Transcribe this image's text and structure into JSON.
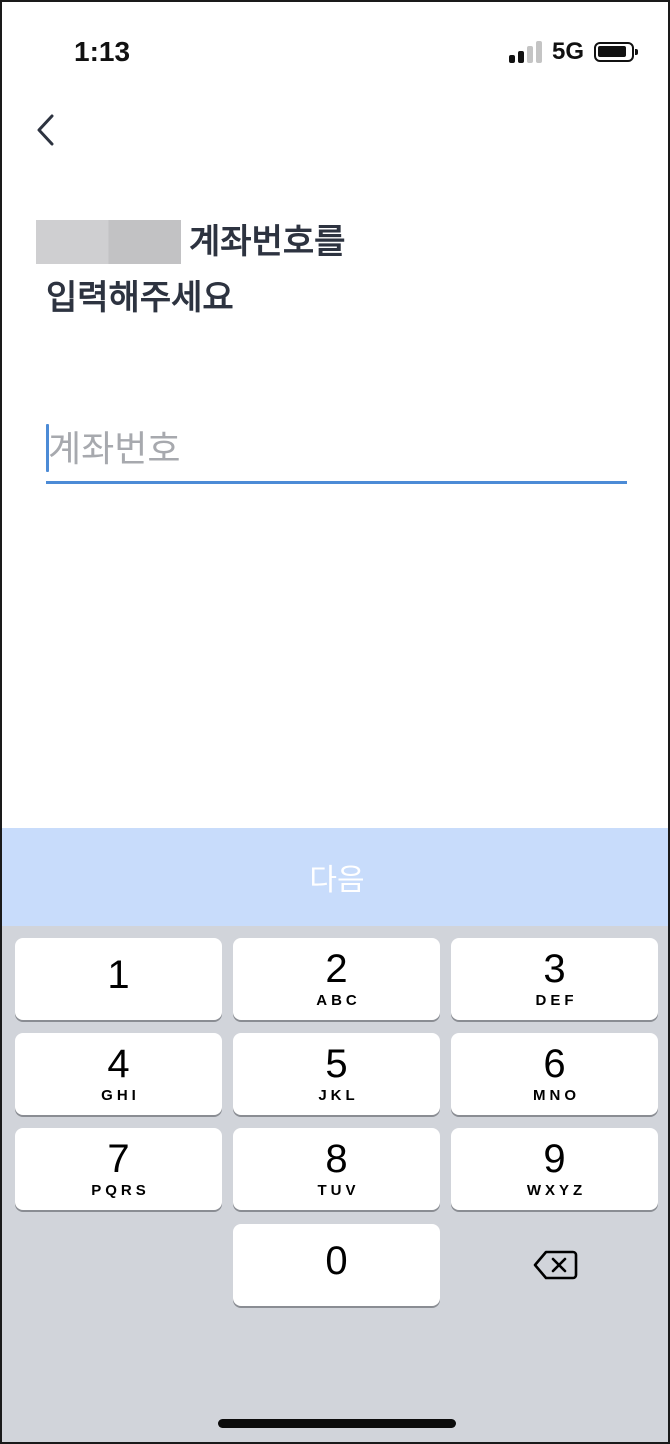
{
  "status_bar": {
    "time": "1:13",
    "network": "5G"
  },
  "header": {
    "back_icon": "chevron-left-icon"
  },
  "title": {
    "line1": "계좌번호를",
    "line2": "입력해주세요"
  },
  "account_input": {
    "value": "",
    "placeholder": "계좌번호"
  },
  "next_button": {
    "label": "다음"
  },
  "keypad": {
    "keys": [
      {
        "num": "1",
        "letters": ""
      },
      {
        "num": "2",
        "letters": "ABC"
      },
      {
        "num": "3",
        "letters": "DEF"
      },
      {
        "num": "4",
        "letters": "GHI"
      },
      {
        "num": "5",
        "letters": "JKL"
      },
      {
        "num": "6",
        "letters": "MNO"
      },
      {
        "num": "7",
        "letters": "PQRS"
      },
      {
        "num": "8",
        "letters": "TUV"
      },
      {
        "num": "9",
        "letters": "WXYZ"
      },
      {
        "num": "0",
        "letters": ""
      }
    ],
    "delete_icon": "backspace-icon"
  },
  "colors": {
    "accent": "#4c8bd6",
    "next_button_bg": "#c8dcfb",
    "keypad_bg": "#d1d4da",
    "title_text": "#2d3340"
  }
}
